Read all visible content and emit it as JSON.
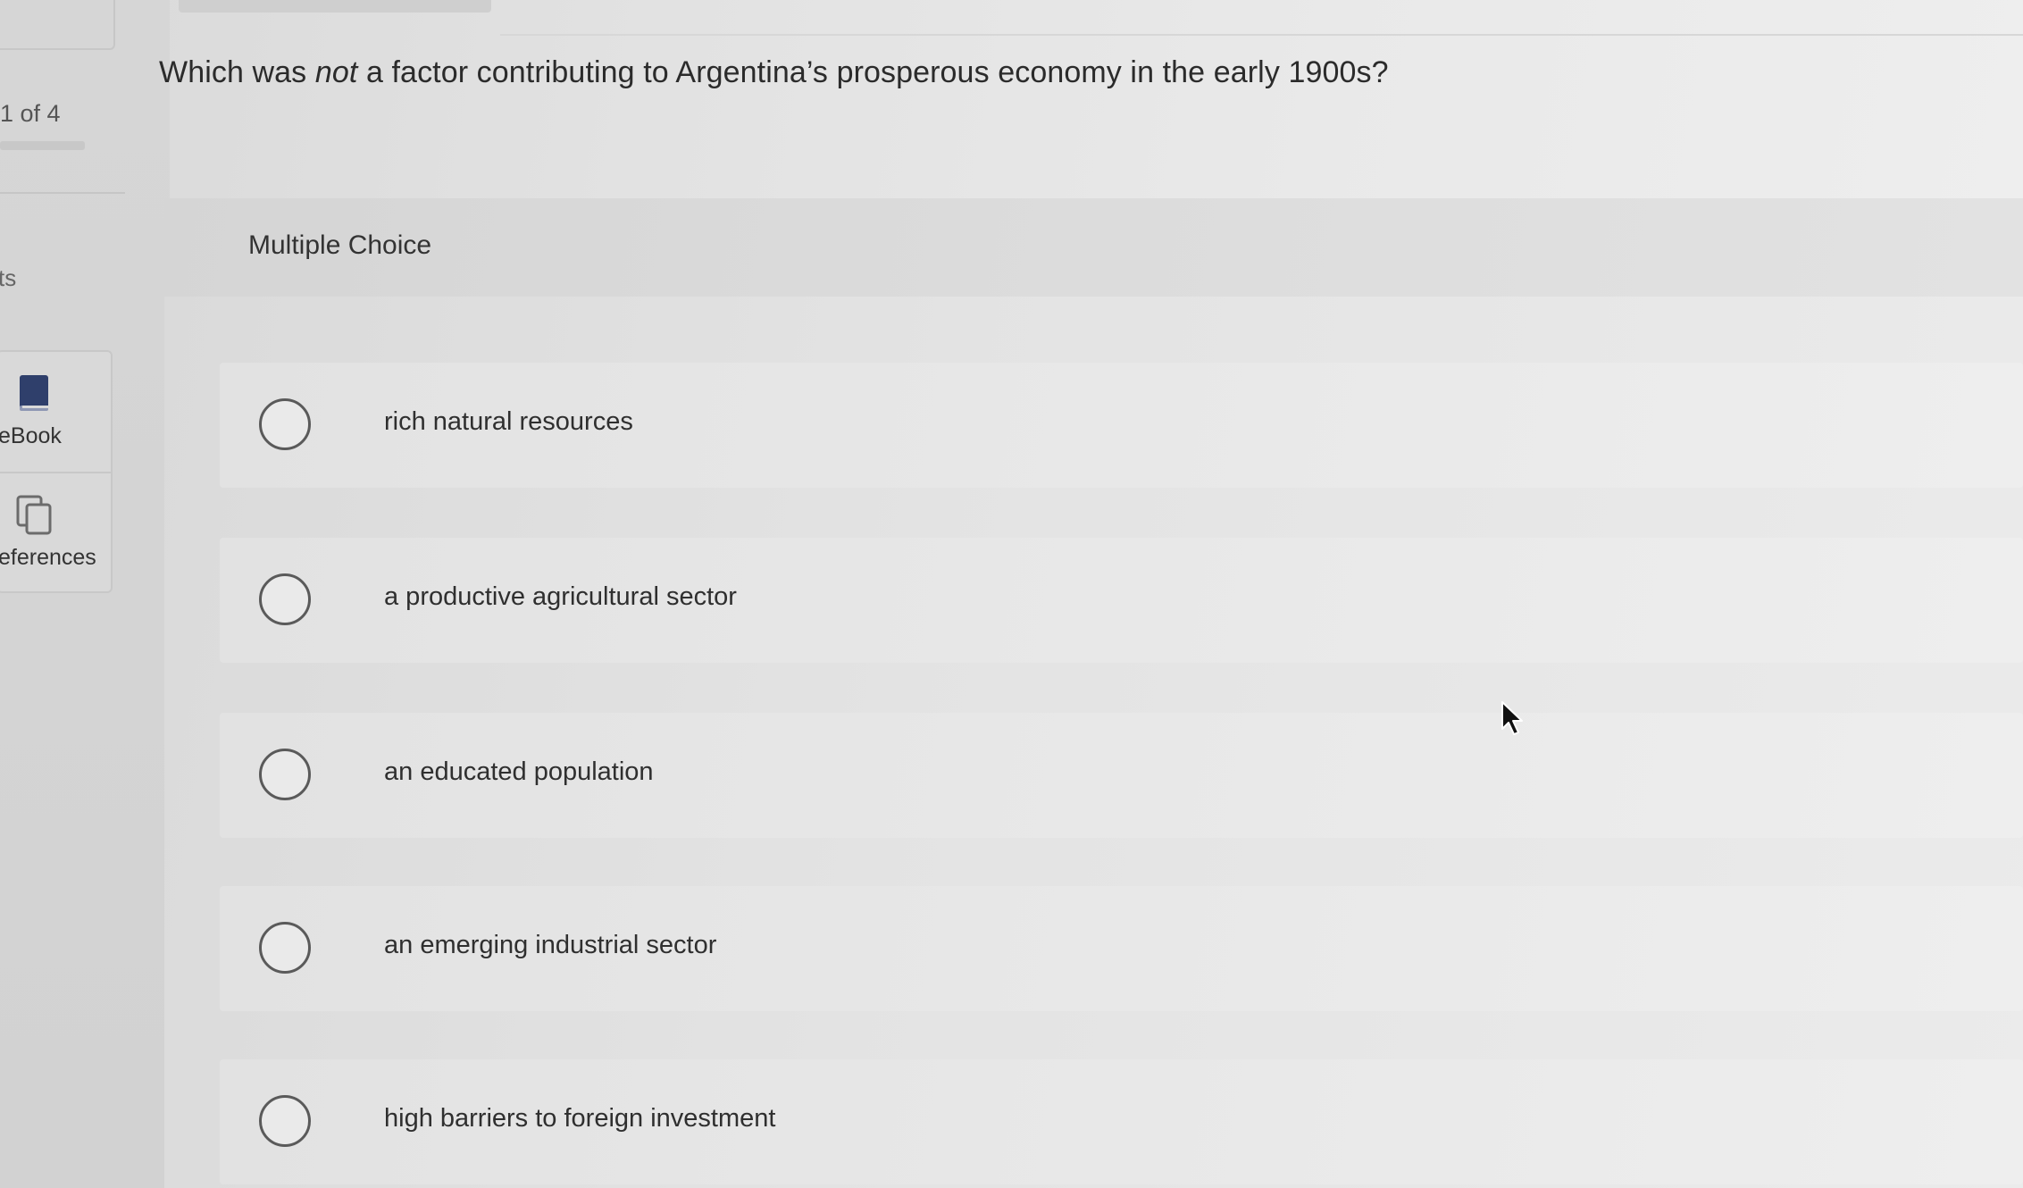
{
  "sidebar": {
    "question_counter": "1 of 4",
    "parts_label": "ts",
    "tools": [
      {
        "label": "eBook",
        "icon": "book-icon"
      },
      {
        "label": "eferences",
        "icon": "copy-pages-icon"
      }
    ]
  },
  "question": {
    "prefix": "Which was ",
    "emphasis": "not",
    "suffix": " a factor contributing to Argentina’s prosperous economy in the early 1900s?"
  },
  "choice_block": {
    "type_label": "Multiple Choice",
    "options": [
      {
        "label": "rich natural resources",
        "selected": false
      },
      {
        "label": "a productive agricultural sector",
        "selected": false
      },
      {
        "label": "an educated population",
        "selected": false
      },
      {
        "label": "an emerging industrial sector",
        "selected": false
      },
      {
        "label": "high barriers to foreign investment",
        "selected": false
      }
    ]
  },
  "colors": {
    "background": "#e4e4e4",
    "ebook_icon": "#2f3f6b",
    "radio_border": "#5a5a5a",
    "text": "#2b2b2b"
  }
}
